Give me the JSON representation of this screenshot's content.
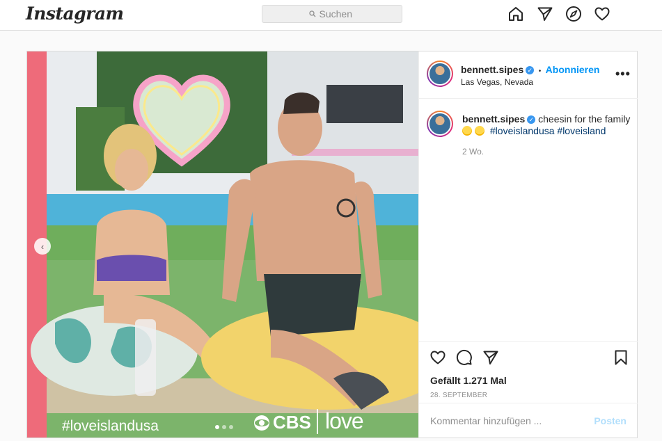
{
  "header": {
    "logo": "Instagram",
    "search_placeholder": "Suchen",
    "icons": [
      "home-icon",
      "direct-icon",
      "explore-icon",
      "activity-icon"
    ]
  },
  "post": {
    "username": "bennett.sipes",
    "verified": true,
    "separator": "•",
    "follow_label": "Abonnieren",
    "location": "Las Vegas, Nevada",
    "caption_text": "cheesin for the family",
    "caption_emojis": [
      "grinning-face-emoji",
      "grinning-face-emoji"
    ],
    "hashtags": [
      "#loveislandusa",
      "#loveisland"
    ],
    "time_ago": "2 Wo.",
    "likes": "Gefällt 1.271 Mal",
    "date": "28. SEPTEMBER",
    "comment_placeholder": "Kommentar hinzufügen ...",
    "post_button": "Posten",
    "more_label": "•••",
    "carousel_prev": "‹"
  },
  "media": {
    "overlay_hashtag": "#loveislandusa",
    "network_logo": "CBS",
    "show_logo": "love island",
    "colors": {
      "grass": "#7cb46b",
      "pool": "#4fb3d9",
      "heart_neon": "#f6a3c8",
      "beanbag_yellow": "#f2d36b",
      "beanbag_pattern": "#5fb0a7",
      "left_stripe": "#ee6b7a"
    }
  },
  "colors": {
    "accent": "#0095f6",
    "hashtag": "#00376b",
    "muted": "#8e8e8e",
    "border": "#dbdbdb"
  }
}
